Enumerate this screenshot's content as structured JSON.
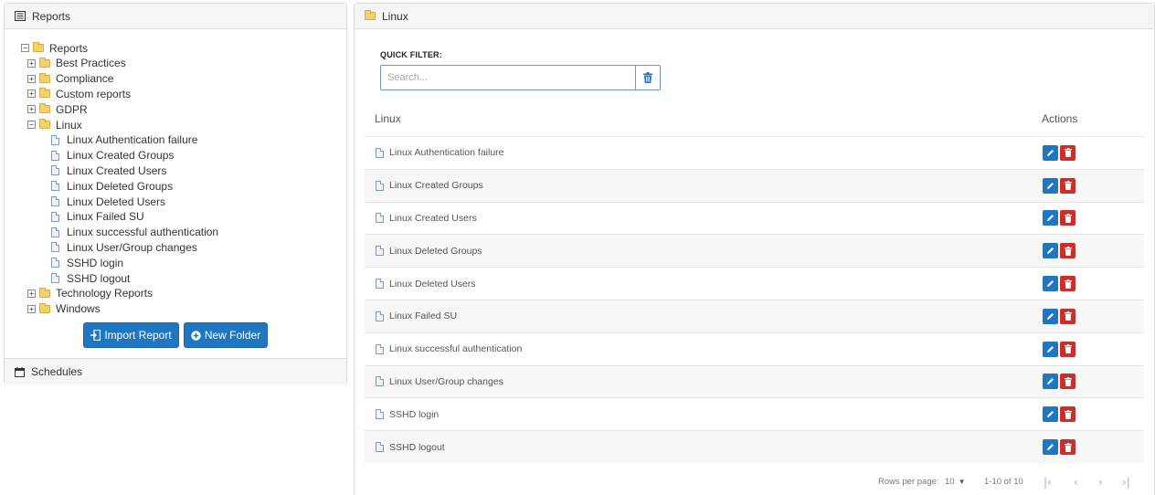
{
  "left": {
    "reports_header": "Reports",
    "schedules_header": "Schedules",
    "tree": [
      {
        "label": "Reports",
        "kind": "folder",
        "toggle": "−",
        "level": 0
      },
      {
        "label": "Best Practices",
        "kind": "folder",
        "toggle": "+",
        "level": 1
      },
      {
        "label": "Compliance",
        "kind": "folder",
        "toggle": "+",
        "level": 1
      },
      {
        "label": "Custom reports",
        "kind": "folder",
        "toggle": "+",
        "level": 1
      },
      {
        "label": "GDPR",
        "kind": "folder",
        "toggle": "+",
        "level": 1
      },
      {
        "label": "Linux",
        "kind": "folder",
        "toggle": "−",
        "level": 1
      },
      {
        "label": "Linux Authentication failure",
        "kind": "doc",
        "level": 2
      },
      {
        "label": "Linux Created Groups",
        "kind": "doc",
        "level": 2
      },
      {
        "label": "Linux Created Users",
        "kind": "doc",
        "level": 2
      },
      {
        "label": "Linux Deleted Groups",
        "kind": "doc",
        "level": 2
      },
      {
        "label": "Linux Deleted Users",
        "kind": "doc",
        "level": 2
      },
      {
        "label": "Linux Failed SU",
        "kind": "doc",
        "level": 2
      },
      {
        "label": "Linux successful authentication",
        "kind": "doc",
        "level": 2
      },
      {
        "label": "Linux User/Group changes",
        "kind": "doc",
        "level": 2
      },
      {
        "label": "SSHD login",
        "kind": "doc",
        "level": 2
      },
      {
        "label": "SSHD logout",
        "kind": "doc",
        "level": 2
      },
      {
        "label": "Technology Reports",
        "kind": "folder",
        "toggle": "+",
        "level": 1
      },
      {
        "label": "Windows",
        "kind": "folder",
        "toggle": "+",
        "level": 1
      }
    ],
    "import_button": "Import Report",
    "new_folder_button": "New Folder"
  },
  "right": {
    "header": "Linux",
    "quick_filter_label": "QUICK FILTER:",
    "search_placeholder": "Search...",
    "col_name": "Linux",
    "col_actions": "Actions",
    "rows": [
      "Linux Authentication failure",
      "Linux Created Groups",
      "Linux Created Users",
      "Linux Deleted Groups",
      "Linux Deleted Users",
      "Linux Failed SU",
      "Linux successful authentication",
      "Linux User/Group changes",
      "SSHD login",
      "SSHD logout"
    ],
    "footer": {
      "rows_per_page_label": "Rows per page:",
      "rows_per_page_value": "10",
      "range": "1-10 of 10"
    }
  },
  "colors": {
    "primary": "#1f77c4",
    "danger": "#c9302c",
    "folder": "#f3d26b"
  }
}
